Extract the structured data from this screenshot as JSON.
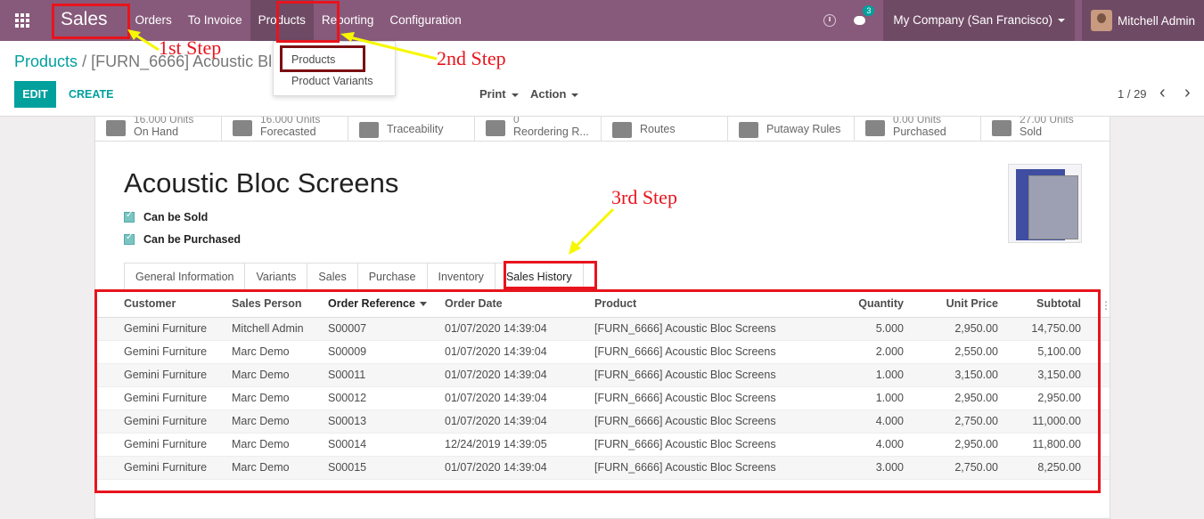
{
  "topbar": {
    "app_name": "Sales",
    "menu": [
      "Orders",
      "To Invoice",
      "Products",
      "Reporting",
      "Configuration"
    ],
    "notification_count": "3",
    "company": "My Company (San Francisco)",
    "user": "Mitchell Admin",
    "color": "#875a7b"
  },
  "products_dropdown": [
    "Products",
    "Product Variants"
  ],
  "breadcrumb": {
    "root": "Products",
    "separator": "/",
    "current": "[FURN_6666] Acoustic Bl"
  },
  "buttons": {
    "edit": "EDIT",
    "create": "CREATE",
    "print": "Print",
    "action": "Action"
  },
  "pager": {
    "value": "1 / 29",
    "prev": "‹",
    "next": "›"
  },
  "stats": [
    {
      "value": "16.000 Units",
      "label": "On Hand"
    },
    {
      "value": "16.000 Units",
      "label": "Forecasted"
    },
    {
      "value": "",
      "label": "Traceability"
    },
    {
      "value": "0",
      "label": "Reordering R..."
    },
    {
      "value": "",
      "label": "Routes"
    },
    {
      "value": "",
      "label": "Putaway Rules"
    },
    {
      "value": "0.00 Units",
      "label": "Purchased"
    },
    {
      "value": "27.00 Units",
      "label": "Sold"
    }
  ],
  "product": {
    "name": "Acoustic Bloc Screens",
    "can_be_sold": "Can be Sold",
    "can_be_purchased": "Can be Purchased"
  },
  "tabs": [
    "General Information",
    "Variants",
    "Sales",
    "Purchase",
    "Inventory",
    "Sales History"
  ],
  "table": {
    "headers": [
      "Customer",
      "Sales Person",
      "Order Reference",
      "Order Date",
      "Product",
      "Quantity",
      "Unit Price",
      "Subtotal"
    ],
    "rows": [
      [
        "Gemini Furniture",
        "Mitchell Admin",
        "S00007",
        "01/07/2020 14:39:04",
        "[FURN_6666] Acoustic Bloc Screens",
        "5.000",
        "2,950.00",
        "14,750.00"
      ],
      [
        "Gemini Furniture",
        "Marc Demo",
        "S00009",
        "01/07/2020 14:39:04",
        "[FURN_6666] Acoustic Bloc Screens",
        "2.000",
        "2,550.00",
        "5,100.00"
      ],
      [
        "Gemini Furniture",
        "Marc Demo",
        "S00011",
        "01/07/2020 14:39:04",
        "[FURN_6666] Acoustic Bloc Screens",
        "1.000",
        "3,150.00",
        "3,150.00"
      ],
      [
        "Gemini Furniture",
        "Marc Demo",
        "S00012",
        "01/07/2020 14:39:04",
        "[FURN_6666] Acoustic Bloc Screens",
        "1.000",
        "2,950.00",
        "2,950.00"
      ],
      [
        "Gemini Furniture",
        "Marc Demo",
        "S00013",
        "01/07/2020 14:39:04",
        "[FURN_6666] Acoustic Bloc Screens",
        "4.000",
        "2,750.00",
        "11,000.00"
      ],
      [
        "Gemini Furniture",
        "Marc Demo",
        "S00014",
        "12/24/2019 14:39:05",
        "[FURN_6666] Acoustic Bloc Screens",
        "4.000",
        "2,950.00",
        "11,800.00"
      ],
      [
        "Gemini Furniture",
        "Marc Demo",
        "S00015",
        "01/07/2020 14:39:04",
        "[FURN_6666] Acoustic Bloc Screens",
        "3.000",
        "2,750.00",
        "8,250.00"
      ]
    ]
  },
  "annotations": {
    "step1": "1st Step",
    "step2": "2nd Step",
    "step3": "3rd Step",
    "box_color": "#e8141d",
    "arrow_color": "#f7f700"
  }
}
